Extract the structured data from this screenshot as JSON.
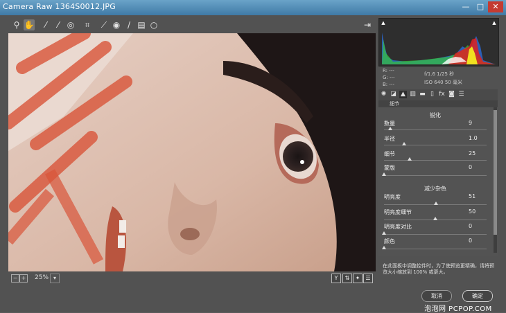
{
  "window": {
    "title": "Camera Raw 1364S0012.JPG",
    "minimize": "—",
    "maximize": "□",
    "close": "✕"
  },
  "toolbar": {
    "tools": [
      {
        "name": "zoom-tool",
        "icon": "magnifier-icon",
        "glyph": "⚲"
      },
      {
        "name": "hand-tool",
        "icon": "hand-icon",
        "glyph": "✋"
      },
      {
        "name": "white-balance-tool",
        "icon": "eyedropper-icon",
        "glyph": "⁄"
      },
      {
        "name": "color-sampler-tool",
        "icon": "eyedropper-plus-icon",
        "glyph": "⁄"
      },
      {
        "name": "targeted-adjustment-tool",
        "icon": "target-adjust-icon",
        "glyph": "◎"
      },
      {
        "name": "crop-tool",
        "icon": "crop-icon",
        "glyph": "⌗"
      },
      {
        "name": "straighten-tool",
        "icon": "straighten-icon",
        "glyph": "⟋"
      },
      {
        "name": "redeye-tool",
        "icon": "redeye-icon",
        "glyph": "◉"
      },
      {
        "name": "spot-removal-tool",
        "icon": "brush-icon",
        "glyph": "/"
      },
      {
        "name": "graduated-filter-tool",
        "icon": "graduated-filter-icon",
        "glyph": "▤"
      },
      {
        "name": "radial-filter-tool",
        "icon": "radial-filter-icon",
        "glyph": "○"
      }
    ],
    "open_preferences_glyph": "⇥"
  },
  "status": {
    "zoom": "25%",
    "zoom_dropdown": "▾"
  },
  "info": {
    "r": "R:  ---",
    "g": "G:  ---",
    "b": "B:  ---",
    "line1": "f/1.6   1/25 秒",
    "line2": "ISO 640   50 毫米"
  },
  "panel": {
    "title": "细节",
    "sharpen_section": "锐化",
    "noise_section": "减少杂色",
    "sharpen": [
      {
        "label": "数量",
        "value": "9",
        "pos": 0.06
      },
      {
        "label": "半径",
        "value": "1.0",
        "pos": 0.2
      },
      {
        "label": "细节",
        "value": "25",
        "pos": 0.25
      },
      {
        "label": "蒙版",
        "value": "0",
        "pos": 0.0
      }
    ],
    "noise": [
      {
        "label": "明亮度",
        "value": "51",
        "pos": 0.51
      },
      {
        "label": "明亮度细节",
        "value": "50",
        "pos": 0.5
      },
      {
        "label": "明亮度对比",
        "value": "0",
        "pos": 0.0
      },
      {
        "label": "颜色",
        "value": "0",
        "pos": 0.0
      }
    ]
  },
  "hint": "在此面板中调整控件时，为了使预览更精确，请将预览大小缩放到 100% 或更大。",
  "buttons": {
    "cancel": "取消",
    "ok": "确定"
  },
  "watermark": "泡泡网  PCPOP.COM"
}
